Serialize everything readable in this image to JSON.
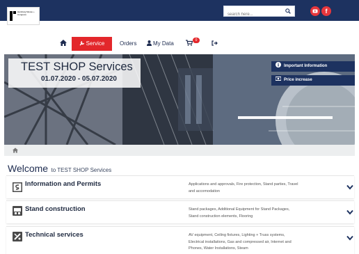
{
  "header": {
    "logo_text": "Hamburg Messe + Congress",
    "search_placeholder": "search here...",
    "search_icon": "search-icon",
    "social": [
      {
        "name": "youtube",
        "icon": "youtube-icon"
      },
      {
        "name": "facebook",
        "icon": "facebook-icon",
        "glyph": "f"
      }
    ],
    "colors": {
      "bar": "#1d3260",
      "accent": "#e3272b"
    }
  },
  "nav": {
    "home_icon": "home-icon",
    "service_label": "Service",
    "orders_label": "Orders",
    "mydata_label": "My Data",
    "cart_icon": "cart-icon",
    "cart_count": "0",
    "logout_icon": "logout-icon"
  },
  "hero": {
    "title": "TEST SHOP Services",
    "dates": "01.07.2020 - 05.07.2020",
    "links": [
      {
        "label": "Important Information",
        "icon": "info-icon"
      },
      {
        "label": "Price increase",
        "icon": "money-icon"
      }
    ]
  },
  "breadcrumb": {
    "icon": "home-icon"
  },
  "welcome": {
    "title": "Welcome",
    "subtitle": "to TEST SHOP Services"
  },
  "services": [
    {
      "title": "Information and Permits",
      "icon": "permit-document-icon",
      "description": "Applications and approvals, Fire protection, Stand parties, Travel and accomodation"
    },
    {
      "title": "Stand construction",
      "icon": "stand-construction-icon",
      "description": "Stand packages, Additional Equipment for Stand Packages, Stand construction elements, Flooring"
    },
    {
      "title": "Technical services",
      "icon": "technical-tools-icon",
      "description": "AV equipment, Ceiling fixtures, Lighting + Truss systems, Electrical installations, Gas and compressed air, Internet and Phones, Water Installations, Steam"
    }
  ]
}
